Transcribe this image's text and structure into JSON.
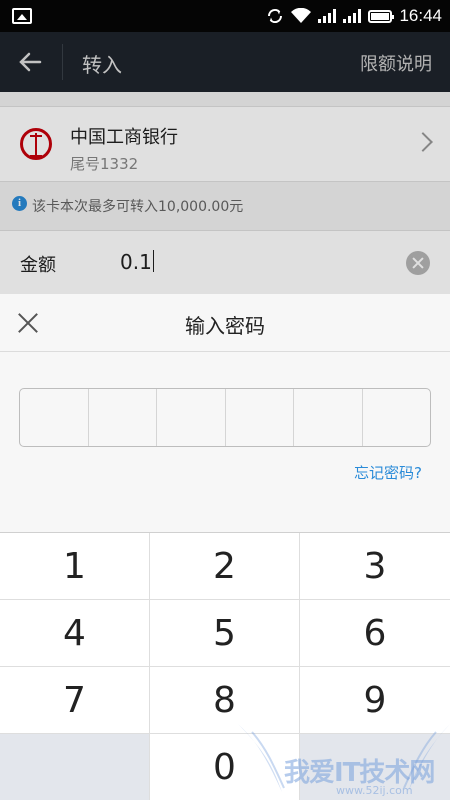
{
  "status_bar": {
    "time": "16:44"
  },
  "toolbar": {
    "title": "转入",
    "right_link": "限额说明"
  },
  "bank": {
    "name": "中国工商银行",
    "tail": "尾号1332"
  },
  "limit_text": "该卡本次最多可转入10,000.00元",
  "amount": {
    "label": "金额",
    "value": "0.1"
  },
  "password_panel": {
    "title": "输入密码",
    "forgot": "忘记密码?"
  },
  "keypad": {
    "keys": [
      "1",
      "2",
      "3",
      "4",
      "5",
      "6",
      "7",
      "8",
      "9",
      "",
      "0",
      ""
    ]
  },
  "watermark": {
    "text": "我爱IT技术网",
    "sub": "www.52ij.com"
  }
}
